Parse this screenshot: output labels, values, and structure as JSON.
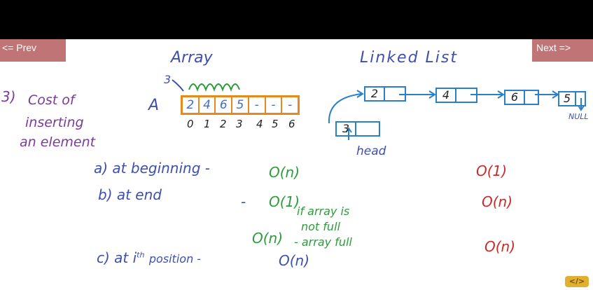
{
  "nav": {
    "prev_label": "<= Prev",
    "next_label": "Next =>"
  },
  "titles": {
    "array": "Array",
    "linked_list": "Linked List"
  },
  "heading": {
    "num": "3)",
    "line1": "Cost of",
    "line2": "inserting",
    "line3": "an element"
  },
  "array": {
    "name": "A",
    "insert_value": "3",
    "cells": [
      "2",
      "4",
      "6",
      "5",
      "-",
      "-",
      "-"
    ],
    "indices": [
      "0",
      "1",
      "2",
      "3",
      "4",
      "5",
      "6"
    ]
  },
  "linked_list": {
    "nodes": [
      "2",
      "4",
      "6",
      "5"
    ],
    "new_node": "3",
    "head_label": "head",
    "null_label": "NULL"
  },
  "rows": {
    "a_label": "a) at beginning -",
    "a_array": "O(n)",
    "a_list": "O(1)",
    "b_label": "b) at end",
    "b_dash": "-",
    "b_array": "O(1)",
    "b_note1": "if array is",
    "b_note2": "not full",
    "b_array2": "O(n)",
    "b_note3": "- array full",
    "b_list": "O(n)",
    "c_label": "c) at i",
    "c_sup": "th",
    "c_label2": "position -",
    "c_array": "O(n)",
    "c_list": "O(n)"
  },
  "colors": {
    "topbar": "#000000",
    "nav_button": "#c07476",
    "array_border": "#e68a1e",
    "node_border": "#2a7fc9"
  },
  "logo_text": "</>"
}
